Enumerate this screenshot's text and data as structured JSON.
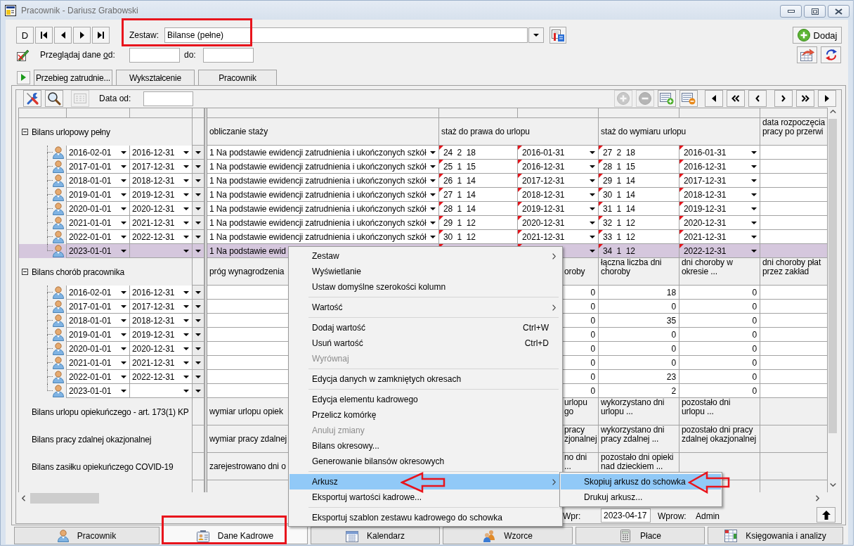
{
  "window": {
    "title": "Pracownik - Dariusz Grabowski"
  },
  "record_nav": {
    "label": "D"
  },
  "set_selector": {
    "label": "Zestaw:",
    "value": "Bilanse (pełne)"
  },
  "add_button": {
    "label": "Dodaj"
  },
  "date_filter": {
    "label_before": "Przeglądaj dane ",
    "label_key": "o",
    "label_after": "d:",
    "to_label": "do:"
  },
  "tabs": [
    {
      "label": "Przebieg zatrudnie...",
      "selected": false
    },
    {
      "label": "Wykształcenie",
      "selected": false
    },
    {
      "label": "Pracownik",
      "selected": false
    }
  ],
  "panel_toolbar": {
    "tools": [
      {
        "disabled": false
      },
      {
        "disabled": false
      },
      {
        "disabled": true
      }
    ],
    "date_label": "Data od:",
    "actions": [
      {
        "disabled": true
      },
      {
        "disabled": true
      },
      {
        "disabled": false
      },
      {
        "disabled": false
      }
    ]
  },
  "grid": {
    "groups": [
      {
        "kind": "tree",
        "title": "Bilans urlopowy pełny",
        "expanded": true,
        "headers": [
          {
            "kind": "single",
            "text": "obliczanie staży"
          },
          {
            "kind": "double",
            "text": "staż do prawa do urlopu"
          },
          {
            "kind": "double",
            "text": "staż do wymiaru urlopu"
          },
          {
            "kind": "single",
            "text": "data rozpoczęcia\npracy po przerwi"
          }
        ],
        "columns": [
          {
            "kind": "choice",
            "flagged": false
          },
          {
            "kind": "text",
            "flagged": true
          },
          {
            "kind": "date",
            "flagged": true
          },
          {
            "kind": "text",
            "flagged": true
          },
          {
            "kind": "date",
            "flagged": true
          },
          {
            "kind": "text",
            "flagged": false
          }
        ],
        "rows": [
          {
            "from": "2016-02-01",
            "to": "2016-12-31",
            "selected": false,
            "cells": [
              "1 Na podstawie ewidencji zatrudnienia i ukończonych szkół",
              "24  2  18",
              "2016-01-31",
              "27  2  18",
              "2016-01-31",
              null
            ]
          },
          {
            "from": "2017-01-01",
            "to": "2017-12-31",
            "selected": false,
            "cells": [
              "1 Na podstawie ewidencji zatrudnienia i ukończonych szkół",
              "25  1  15",
              "2016-12-31",
              "28  1  15",
              "2016-12-31",
              null
            ]
          },
          {
            "from": "2018-01-01",
            "to": "2018-12-31",
            "selected": false,
            "cells": [
              "1 Na podstawie ewidencji zatrudnienia i ukończonych szkół",
              "26  1  14",
              "2017-12-31",
              "29  1  14",
              "2017-12-31",
              null
            ]
          },
          {
            "from": "2019-01-01",
            "to": "2019-12-31",
            "selected": false,
            "cells": [
              "1 Na podstawie ewidencji zatrudnienia i ukończonych szkół",
              "27  1  14",
              "2018-12-31",
              "30  1  14",
              "2018-12-31",
              null
            ]
          },
          {
            "from": "2020-01-01",
            "to": "2020-12-31",
            "selected": false,
            "cells": [
              "1 Na podstawie ewidencji zatrudnienia i ukończonych szkół",
              "28  1  14",
              "2019-12-31",
              "31  1  14",
              "2019-12-31",
              null
            ]
          },
          {
            "from": "2021-01-01",
            "to": "2021-12-31",
            "selected": false,
            "cells": [
              "1 Na podstawie ewidencji zatrudnienia i ukończonych szkół",
              "29  1  12",
              "2020-12-31",
              "32  1  12",
              "2020-12-31",
              null
            ]
          },
          {
            "from": "2022-01-01",
            "to": "2022-12-31",
            "selected": false,
            "cells": [
              "1 Na podstawie ewidencji zatrudnienia i ukończonych szkół",
              "30  1  12",
              "2021-12-31",
              "33  1  12",
              "2021-12-31",
              null
            ]
          },
          {
            "from": "2023-01-01",
            "to": null,
            "selected": true,
            "cells": [
              "1 Na podstawie ewid",
              null,
              null,
              "34  1  12",
              "2022-12-31",
              null
            ]
          }
        ]
      },
      {
        "kind": "tree",
        "title": "Bilans chorób pracownika",
        "expanded": true,
        "headers": [
          {
            "kind": "single",
            "text": "próg wynagrodzenia"
          },
          {
            "kind": "single"
          },
          {
            "kind": "fragment",
            "text": "oroby"
          },
          {
            "kind": "single",
            "text": "łączna liczba dni\nchoroby"
          },
          {
            "kind": "single",
            "text": "dni choroby w\nokresie ..."
          },
          {
            "kind": "single",
            "text": "dni choroby płat\nprzez zakład"
          }
        ],
        "columns": [
          {
            "kind": "text"
          },
          {
            "kind": "number"
          },
          {
            "kind": "number"
          },
          {
            "kind": "number",
            "flagged": false
          },
          {
            "kind": "number",
            "flagged": false
          },
          {
            "kind": "text",
            "flagged": false
          }
        ],
        "rows": [
          {
            "from": "2016-02-01",
            "to": "2016-12-31",
            "selected": false,
            "cells": [
              null,
              null,
              "0",
              "18",
              "0",
              null
            ]
          },
          {
            "from": "2017-01-01",
            "to": "2017-12-31",
            "selected": false,
            "cells": [
              null,
              null,
              "0",
              "0",
              "0",
              null
            ]
          },
          {
            "from": "2018-01-01",
            "to": "2018-12-31",
            "selected": false,
            "cells": [
              null,
              null,
              "0",
              "35",
              "0",
              null
            ]
          },
          {
            "from": "2019-01-01",
            "to": "2019-12-31",
            "selected": false,
            "cells": [
              null,
              null,
              "0",
              "0",
              "0",
              null
            ]
          },
          {
            "from": "2020-01-01",
            "to": "2020-12-31",
            "selected": false,
            "cells": [
              null,
              null,
              "0",
              "0",
              "0",
              null
            ]
          },
          {
            "from": "2021-01-01",
            "to": "2021-12-31",
            "selected": false,
            "cells": [
              null,
              null,
              "0",
              "0",
              "0",
              null
            ]
          },
          {
            "from": "2022-01-01",
            "to": "2022-12-31",
            "selected": false,
            "cells": [
              null,
              null,
              "0",
              "23",
              "0",
              null
            ]
          },
          {
            "from": "2023-01-01",
            "to": null,
            "selected": false,
            "cells": [
              null,
              null,
              "0",
              "2",
              "0",
              null
            ]
          }
        ]
      },
      {
        "kind": "plain",
        "title": "Bilans urlopu opiekuńczego - art. 173(1) KP",
        "headers": [
          {
            "kind": "single",
            "text": "wymiar urlopu opiek"
          },
          {
            "kind": "single"
          },
          {
            "kind": "fragment",
            "text": "urlopu\ngo"
          },
          {
            "kind": "single",
            "text": "wykorzystano dni\nurlopu ..."
          },
          {
            "kind": "single",
            "text": "pozostało dni\nurlopu ..."
          },
          {
            "kind": "single"
          }
        ]
      },
      {
        "kind": "plain",
        "title": "Bilans pracy zdalnej okazjonalnej",
        "headers": [
          {
            "kind": "single",
            "text": "wymiar pracy zdalnej"
          },
          {
            "kind": "single"
          },
          {
            "kind": "fragment",
            "text": "pracy\nzjonalnej"
          },
          {
            "kind": "single",
            "text": "wykorzystano dni\npracy zdalnej ..."
          },
          {
            "kind": "single",
            "text": "pozostało dni pracy\nzdalnej okazjonalnej"
          },
          {
            "kind": "single"
          }
        ]
      },
      {
        "kind": "plain",
        "title": "Bilans zasiłku opiekuńczego COVID-19",
        "headers": [
          {
            "kind": "single",
            "text": "zarejestrowano dni o"
          },
          {
            "kind": "single"
          },
          {
            "kind": "fragment",
            "text": "no dni\n..."
          },
          {
            "kind": "single",
            "text": "pozostało dni opieki\nnad dzieckiem ..."
          },
          {
            "kind": "single"
          },
          {
            "kind": "single"
          }
        ]
      }
    ]
  },
  "record_info": {
    "entered_label": "Wpr:",
    "entered_date": "2023-04-17",
    "operator_label": "Wprow:",
    "operator": "Admin"
  },
  "modules": [
    {
      "label": "Pracownik",
      "selected": false
    },
    {
      "label": "Dane Kadrowe",
      "selected": true
    },
    {
      "label": "Kalendarz",
      "selected": false
    },
    {
      "label": "Wzorce",
      "selected": false
    },
    {
      "label": "Płace",
      "selected": false
    },
    {
      "label": "Księgowania i analizy",
      "selected": false
    }
  ],
  "context_menu": {
    "items": [
      {
        "kind": "item",
        "label": "Zestaw",
        "submenu": true,
        "disabled": false,
        "highlighted": false
      },
      {
        "kind": "item",
        "label": "Wyświetlanie",
        "submenu": false,
        "disabled": false,
        "highlighted": false
      },
      {
        "kind": "item",
        "label": "Ustaw domyślne szerokości kolumn",
        "submenu": false,
        "disabled": false,
        "highlighted": false
      },
      {
        "kind": "separator"
      },
      {
        "kind": "item",
        "label": "Wartość",
        "submenu": true,
        "disabled": false,
        "highlighted": false
      },
      {
        "kind": "separator"
      },
      {
        "kind": "item",
        "label": "Dodaj wartość",
        "shortcut": "Ctrl+W",
        "submenu": false,
        "disabled": false,
        "highlighted": false
      },
      {
        "kind": "item",
        "label": "Usuń wartość",
        "shortcut": "Ctrl+D",
        "submenu": false,
        "disabled": false,
        "highlighted": false
      },
      {
        "kind": "item",
        "label": "Wyrównaj",
        "submenu": false,
        "disabled": true,
        "highlighted": false
      },
      {
        "kind": "separator"
      },
      {
        "kind": "item",
        "label": "Edycja danych w zamkniętych okresach",
        "submenu": false,
        "disabled": false,
        "highlighted": false
      },
      {
        "kind": "separator"
      },
      {
        "kind": "item",
        "label": "Edycja elementu kadrowego",
        "submenu": false,
        "disabled": false,
        "highlighted": false
      },
      {
        "kind": "item",
        "label": "Przelicz komórkę",
        "submenu": false,
        "disabled": false,
        "highlighted": false
      },
      {
        "kind": "item",
        "label": "Anuluj zmiany",
        "submenu": false,
        "disabled": true,
        "highlighted": false
      },
      {
        "kind": "item",
        "label": "Bilans okresowy...",
        "submenu": false,
        "disabled": false,
        "highlighted": false
      },
      {
        "kind": "item",
        "label": "Generowanie bilansów okresowych",
        "submenu": false,
        "disabled": false,
        "highlighted": false
      },
      {
        "kind": "separator"
      },
      {
        "kind": "item",
        "label": "Arkusz",
        "submenu": true,
        "disabled": false,
        "highlighted": true
      },
      {
        "kind": "item",
        "label": "Eksportuj wartości kadrowe...",
        "submenu": false,
        "disabled": false,
        "highlighted": false
      },
      {
        "kind": "separator"
      },
      {
        "kind": "item",
        "label": "Eksportuj szablon zestawu kadrowego do schowka",
        "submenu": false,
        "disabled": false,
        "highlighted": false
      }
    ]
  },
  "submenu": {
    "items": [
      {
        "kind": "item",
        "label": "Skopiuj arkusz do schowka",
        "highlighted": true
      },
      {
        "kind": "item",
        "label": "Drukuj arkusz...",
        "highlighted": false
      }
    ]
  }
}
